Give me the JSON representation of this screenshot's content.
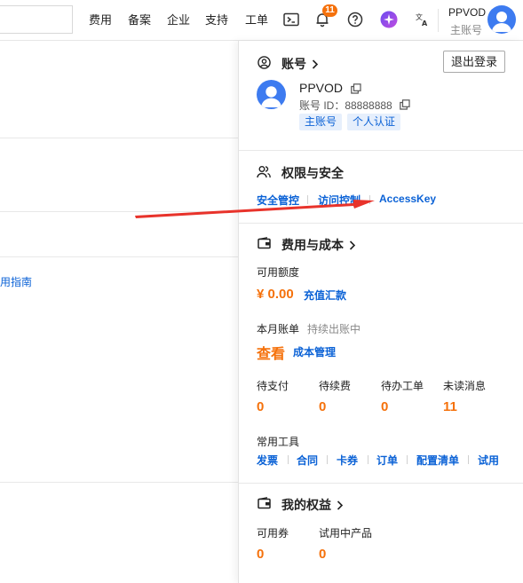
{
  "topbar": {
    "nav": [
      "费用",
      "备案",
      "企业",
      "支持",
      "工单"
    ],
    "notification_count": "11",
    "user_name": "PPVOD",
    "user_role": "主账号"
  },
  "left": {
    "guide_link": "费用指南"
  },
  "panel": {
    "account": {
      "title": "账号",
      "logout_label": "退出登录",
      "name": "PPVOD",
      "id_text": "账号 ID：88888888",
      "tags": [
        "主账号",
        "个人认证"
      ]
    },
    "security": {
      "title": "权限与安全",
      "links": [
        "安全管控",
        "访问控制",
        "AccessKey"
      ]
    },
    "billing": {
      "title": "费用与成本",
      "balance_label": "可用额度",
      "balance_value": "¥ 0.00",
      "recharge_label": "充值汇款",
      "bill_label": "本月账单",
      "bill_status": "持续出账中",
      "view_label": "查看",
      "cost_mgmt_label": "成本管理",
      "stats": [
        {
          "label": "待支付",
          "value": "0"
        },
        {
          "label": "待续费",
          "value": "0"
        },
        {
          "label": "待办工单",
          "value": "0"
        },
        {
          "label": "未读消息",
          "value": "11"
        }
      ],
      "tools_label": "常用工具",
      "tools": [
        "发票",
        "合同",
        "卡券",
        "订单",
        "配置清单",
        "试用"
      ]
    },
    "benefits": {
      "title": "我的权益",
      "stats": [
        {
          "label": "可用券",
          "value": "0"
        },
        {
          "label": "试用中产品",
          "value": "0"
        }
      ]
    }
  },
  "colors": {
    "accent_blue": "#0b62d6",
    "orange": "#f5710b",
    "arrow_red": "#e8332b"
  }
}
